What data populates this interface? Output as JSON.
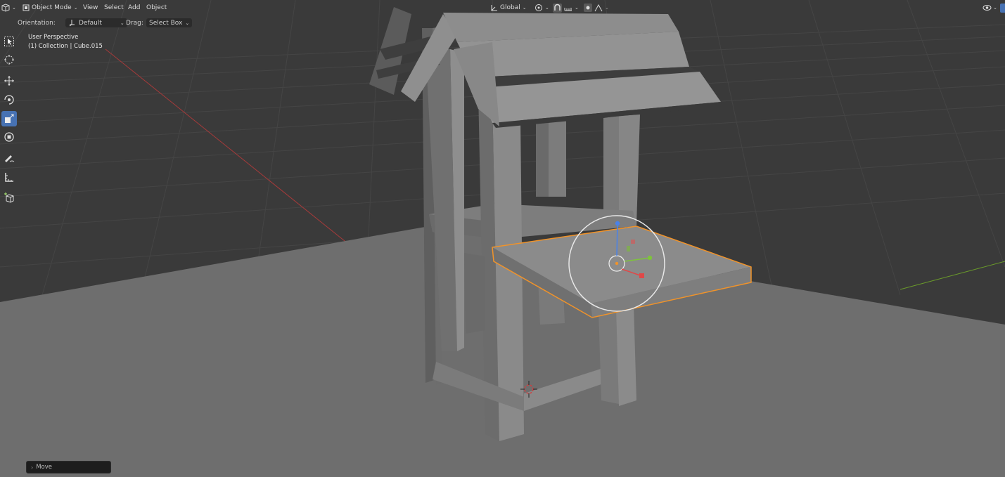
{
  "header": {
    "editor_type_icon": "3d-viewport-icon",
    "mode_label": "Object Mode",
    "menus": [
      "View",
      "Select",
      "Add",
      "Object"
    ],
    "transform_orientation": "Global",
    "icons": [
      "transform-orientation-icon",
      "pivot-point-icon",
      "snap-icon",
      "snap-increment-icon",
      "proportional-editing-icon",
      "falloff-icon",
      "viewport-gizmo-icon"
    ]
  },
  "tool_options": {
    "orientation_label": "Orientation:",
    "orientation_value": "Default",
    "drag_label": "Drag:",
    "drag_value": "Select Box"
  },
  "toolbar": {
    "tools": [
      "select-box-icon",
      "cursor-icon",
      "move-icon",
      "rotate-icon",
      "scale-icon",
      "transform-icon",
      "annotate-icon",
      "measure-icon",
      "add-cube-icon"
    ],
    "active_tool": "scale-icon"
  },
  "viewport": {
    "view_name": "User Perspective",
    "object_info": "(1) Collection | Cube.015",
    "selected_outline_color": "#f0932a",
    "grid_color": "#4a4a4a",
    "x_axis_color": "#a63a3a",
    "y_axis_color": "#6a9a2a"
  },
  "last_operator": {
    "label": "Move",
    "icon": "chevron-right-icon"
  }
}
